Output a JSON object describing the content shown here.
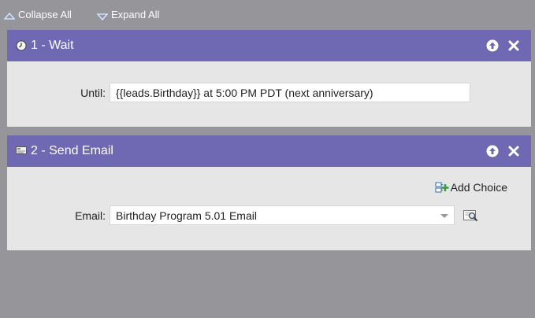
{
  "toolbar": {
    "collapse_all_label": "Collapse All",
    "expand_all_label": "Expand All"
  },
  "steps": [
    {
      "title": "1 - Wait",
      "icon": "clock-icon",
      "fields": [
        {
          "label": "Until:",
          "value": "{{leads.Birthday}} at 5:00 PM PDT (next anniversary)"
        }
      ]
    },
    {
      "title": "2 - Send Email",
      "icon": "email-icon",
      "add_choice_label": "Add Choice",
      "fields": [
        {
          "label": "Email:",
          "value": "Birthday Program 5.01 Email"
        }
      ]
    }
  ],
  "colors": {
    "background": "#96959a",
    "header_purple": "#6f68b2",
    "panel_body": "#e6e6e6"
  }
}
